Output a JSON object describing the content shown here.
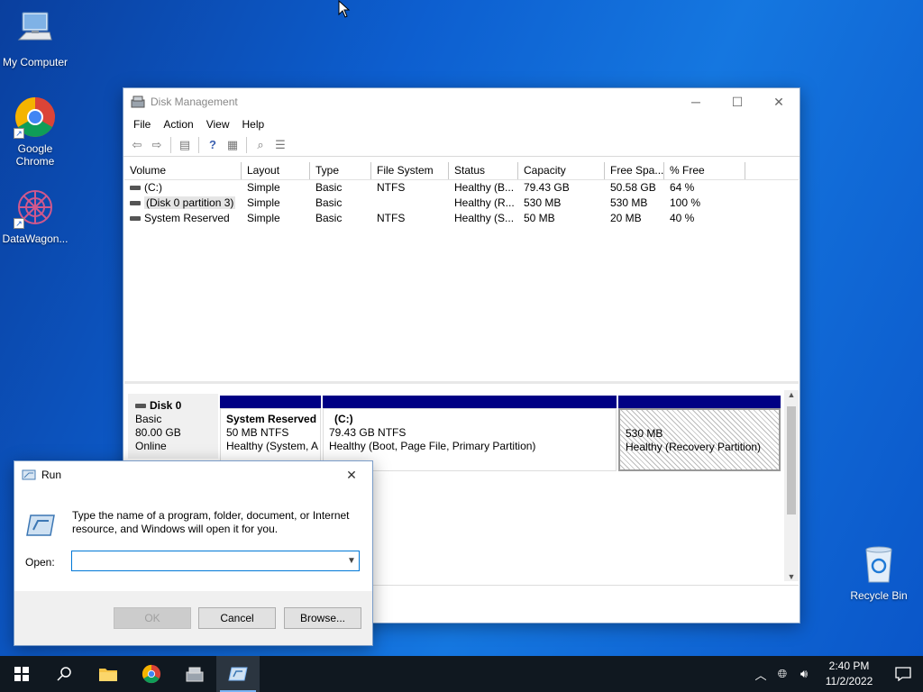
{
  "desktop": {
    "icons": [
      {
        "label": "My Computer",
        "icon": "computer-icon"
      },
      {
        "label": "Google Chrome",
        "icon": "chrome-icon"
      },
      {
        "label": "DataWagon...",
        "icon": "app-icon"
      },
      {
        "label": "Recycle Bin",
        "icon": "recycle-bin-icon"
      }
    ]
  },
  "disk_management": {
    "title": "Disk Management",
    "menu": [
      "File",
      "Action",
      "View",
      "Help"
    ],
    "columns": [
      "Volume",
      "Layout",
      "Type",
      "File System",
      "Status",
      "Capacity",
      "Free Spa...",
      "% Free"
    ],
    "rows": [
      {
        "volume": "(C:)",
        "layout": "Simple",
        "type": "Basic",
        "fs": "NTFS",
        "status": "Healthy (B...",
        "capacity": "79.43 GB",
        "free": "50.58 GB",
        "pct": "64 %"
      },
      {
        "volume": "(Disk 0 partition 3)",
        "layout": "Simple",
        "type": "Basic",
        "fs": "",
        "status": "Healthy (R...",
        "capacity": "530 MB",
        "free": "530 MB",
        "pct": "100 %"
      },
      {
        "volume": "System Reserved",
        "layout": "Simple",
        "type": "Basic",
        "fs": "NTFS",
        "status": "Healthy (S...",
        "capacity": "50 MB",
        "free": "20 MB",
        "pct": "40 %"
      }
    ],
    "disk": {
      "name": "Disk 0",
      "type": "Basic",
      "size": "80.00 GB",
      "state": "Online",
      "partitions": [
        {
          "name": "System Reserved",
          "size": "50 MB NTFS",
          "status": "Healthy (System, A"
        },
        {
          "name": "(C:)",
          "size": "79.43 GB NTFS",
          "status": "Healthy (Boot, Page File, Primary Partition)"
        },
        {
          "name": "",
          "size": "530 MB",
          "status": "Healthy (Recovery Partition)"
        }
      ]
    }
  },
  "run_dialog": {
    "title": "Run",
    "description": "Type the name of a program, folder, document, or Internet resource, and Windows will open it for you.",
    "open_label": "Open:",
    "open_value": "",
    "ok_label": "OK",
    "cancel_label": "Cancel",
    "browse_label": "Browse..."
  },
  "taskbar": {
    "time": "2:40 PM",
    "date": "11/2/2022"
  }
}
